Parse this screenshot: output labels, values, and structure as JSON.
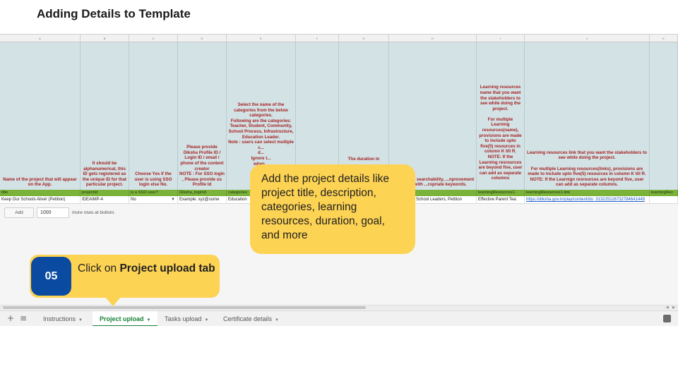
{
  "slide": {
    "title": "Adding Details to Template"
  },
  "sheet": {
    "columns": [
      "A",
      "B",
      "C",
      "D",
      "E",
      "F",
      "G",
      "H",
      "I",
      "J",
      "K"
    ],
    "descriptions": [
      "Name of the project that will appear on the App.",
      "It should be alphanumerical, this ID gets registered as the unique ID for that particular project.",
      "Choose Yes if the user is using SSO login else No.",
      "Please provide Diksha Profile ID / Login ID / email / phone of the content creator\nNOTE : For SSO login , Please provide us Profile Id",
      "Select the name of the categories from the below categories.\nFollowing are the categories:\nTeacher, Student, Community, School Process, Infrastructure, Education Leader.\nNote : users can select multiple c...\nd...\nIgnore t...\nwhen...",
      "",
      "The duration in",
      "...s improve searchability, ...nprovement project with ...ropriate keywords.",
      "Learning resources name that you want the stakeholders to see while doing the project.\n\nFor multiple Learning resources(name), provisions are made to include upto five(5) resources in column K till R.\nNOTE: If the Learning resrources are beyond five, user can add as separate columns",
      "Learning resources link that you want the stakeholders to see while doing the project.\n\nFor multiple Learning resources(links), provisions are made to include upto five(5) resources in column K till R.\nNOTE: If the Learnign resrources are beyond five, user can add as separate columns.",
      ""
    ],
    "keys": [
      "title",
      "projectId",
      "is a SSO user?",
      "Diksha_loginId",
      "categories",
      "",
      "",
      "",
      "learningResources1-",
      "learningResources1-link",
      "learningRes"
    ],
    "values": [
      "Keep Our Schools Alive! (Petition)",
      "IDEAIMP-4",
      "No",
      "Example: xyz@some",
      "Education",
      "",
      "",
      "School Leaders, Petition",
      "Effective Parent Tea:",
      "https://diksha.gov.in/play/content/do_313225116732784641449",
      ""
    ],
    "add_button": "Add",
    "rows_value": "1000",
    "rows_label": "more rows at bottom."
  },
  "tabs": [
    {
      "label": "Instructions",
      "active": false
    },
    {
      "label": "Project upload",
      "active": true
    },
    {
      "label": "Tasks upload",
      "active": false
    },
    {
      "label": "Certificate details",
      "active": false
    }
  ],
  "icons": {
    "add_sheet": "plus-icon",
    "all_sheets": "menu-icon",
    "explore": "explore-icon"
  },
  "callout": {
    "text": "Add the project details like project title, description, categories, learning resources, duration, goal, and more"
  },
  "step": {
    "number": "05",
    "text_prefix": "Click on ",
    "text_bold": "Project upload tab"
  },
  "colors": {
    "callout_bg": "#fdd354",
    "step_badge": "#0a4aa0",
    "header_bg": "#d3e2e5",
    "key_row": "#7bb33a",
    "desc_text": "#a52222",
    "active_tab": "#188038"
  }
}
